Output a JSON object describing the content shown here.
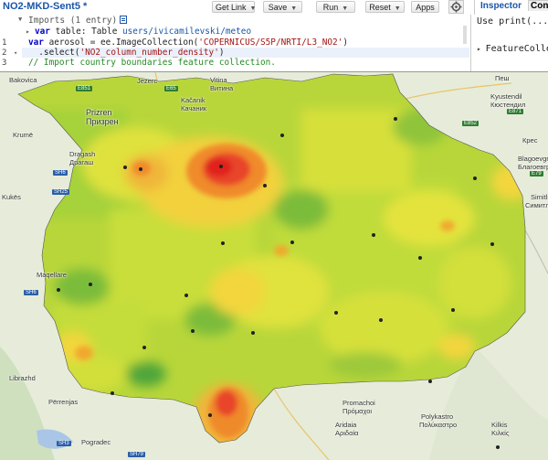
{
  "toolbar": {
    "title": "NO2-MKD-Sent5 *",
    "get_link": "Get Link",
    "save": "Save",
    "run": "Run",
    "reset": "Reset",
    "apps": "Apps"
  },
  "right_panel": {
    "tabs": [
      "Inspector",
      "Cons"
    ],
    "console_line1": "Use print(...) t",
    "console_line2": "FeatureCollect"
  },
  "editor": {
    "imports_header": "Imports (1 entry)",
    "import_line_kw": "var",
    "import_line_name": "table",
    "import_line_rest": ": Table ",
    "import_line_path": "users/ivicamilevski/meteo",
    "line_numbers": [
      "1",
      "2",
      "3"
    ],
    "line1_kw": "var",
    "line1_mid": " aerosol = ",
    "line1_call": "ee.ImageCollection(",
    "line1_str": "'COPERNICUS/S5P/NRTI/L3_NO2'",
    "line1_end": ")",
    "line2_pre": "  .select(",
    "line2_str": "'NO2_column_number_density'",
    "line2_end": ")",
    "line3": "// Import country boundaries feature collection."
  },
  "map": {
    "labels": [
      {
        "t": "Jezerc",
        "k": "jezerc"
      },
      {
        "t": "Vitina",
        "k": "vitina"
      },
      {
        "t": "Витина",
        "k": "vitina-cyr"
      },
      {
        "t": "Kačanik",
        "k": "kacanik"
      },
      {
        "t": "Качаник",
        "k": "kacanik-cyr"
      },
      {
        "t": "Prizren",
        "k": "prizren"
      },
      {
        "t": "Призрен",
        "k": "prizren-cyr"
      },
      {
        "t": "Kukës",
        "k": "kukes"
      },
      {
        "t": "Dragash",
        "k": "dragash"
      },
      {
        "t": "Драгаш",
        "k": "dragash-cyr"
      },
      {
        "t": "Krumë",
        "k": "krume"
      },
      {
        "t": "Maqellare",
        "k": "maqellare"
      },
      {
        "t": "Librazhd",
        "k": "librazhd"
      },
      {
        "t": "Përrenjas",
        "k": "perrenjas"
      },
      {
        "t": "Pogradec",
        "k": "pogradec"
      },
      {
        "t": "Kyustendil",
        "k": "kyustendil"
      },
      {
        "t": "Кюстендил",
        "k": "kyustendil-cyr"
      },
      {
        "t": "Blagoevgr",
        "k": "blagoevgrad"
      },
      {
        "t": "Благоевгр",
        "k": "blagoevgrad-cyr"
      },
      {
        "t": "Simitli",
        "k": "simitli"
      },
      {
        "t": "Симитли",
        "k": "simitli-cyr"
      },
      {
        "t": "Promachoi",
        "k": "promachoi"
      },
      {
        "t": "Πρόμαχοι",
        "k": "promachoi-gr"
      },
      {
        "t": "Aridaia",
        "k": "aridaia"
      },
      {
        "t": "Αριδαία",
        "k": "aridaia-gr"
      },
      {
        "t": "Polykastro",
        "k": "polykastro"
      },
      {
        "t": "Πολύκαστρο",
        "k": "polykastro-gr"
      },
      {
        "t": "Kilkis",
        "k": "kilkis"
      },
      {
        "t": "Κιλκίς",
        "k": "kilkis-gr"
      },
      {
        "t": "Bakovica",
        "k": "bakovica"
      },
      {
        "t": "Пеш",
        "k": "pesh"
      },
      {
        "t": "Крес",
        "k": "kres"
      }
    ],
    "shields": [
      "E851",
      "E65",
      "SH6",
      "SH25",
      "SH6",
      "SH3",
      "SH79",
      "E852",
      "E79",
      "E871"
    ]
  }
}
